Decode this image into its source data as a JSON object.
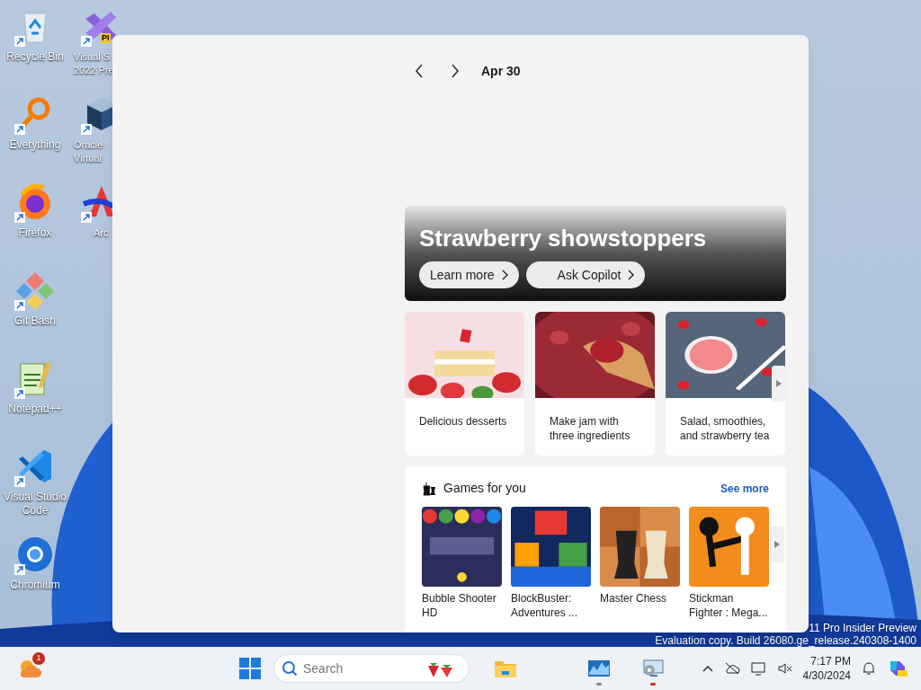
{
  "desktop": {
    "icons": [
      {
        "kind": "recycle",
        "label": "Recycle Bin"
      },
      {
        "kind": "everything",
        "label": "Everything"
      },
      {
        "kind": "firefox",
        "label": "Firefox"
      },
      {
        "kind": "git",
        "label": "Git Bash"
      },
      {
        "kind": "notepad",
        "label": "Notepad++"
      },
      {
        "kind": "vscode",
        "label": "Visual Studio Code"
      },
      {
        "kind": "chromium",
        "label": "Chromium"
      }
    ],
    "partial_icons": [
      {
        "kind": "vs",
        "badge": "PI",
        "lines": [
          "Visual S",
          "2022 Pre"
        ]
      },
      {
        "kind": "virtualbox",
        "lines": [
          "Oracle",
          "Virtual"
        ]
      },
      {
        "kind": "arc",
        "lines": [
          "Arc"
        ]
      }
    ],
    "watermark": [
      "11 Pro Insider Preview",
      "Evaluation copy. Build 26080.ge_release.240308-1400"
    ]
  },
  "panel": {
    "date": "Apr 30",
    "hero": {
      "title": "Strawberry showstoppers",
      "buttons": [
        "Learn more",
        "Ask Copilot"
      ]
    },
    "cards": [
      {
        "title": "Delicious desserts",
        "kind": "cake"
      },
      {
        "title": "Make jam with three ingredients",
        "kind": "jam"
      },
      {
        "title": "Salad, smoothies, and strawberry tea",
        "kind": "drink"
      }
    ],
    "games": {
      "title": "Games for you",
      "link": "See more",
      "items": [
        {
          "title": "Bubble Shooter HD",
          "kind": "bubbles"
        },
        {
          "title": "BlockBuster: Adventures ...",
          "kind": "blocks"
        },
        {
          "title": "Master Chess",
          "kind": "chess"
        },
        {
          "title": "Stickman Fighter : Mega...",
          "kind": "stickman"
        }
      ]
    }
  },
  "taskbar": {
    "weather_badge": "1",
    "search_placeholder": "Search",
    "apps": [
      {
        "kind": "explorer"
      },
      {
        "kind": "monitor",
        "color": "#8a8a8a"
      },
      {
        "kind": "remote",
        "color": "#c42b1c"
      }
    ],
    "time": "7:17 PM",
    "date": "4/30/2024"
  }
}
